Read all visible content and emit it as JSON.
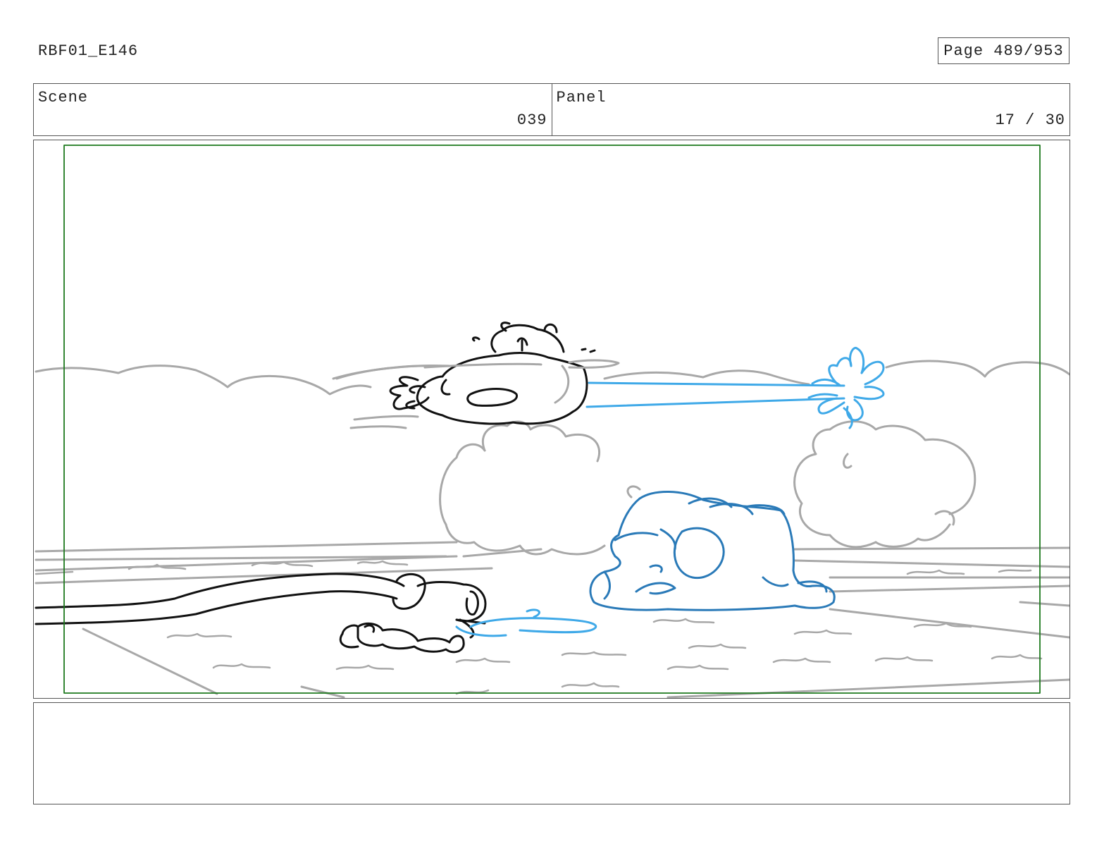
{
  "header": {
    "document_id": "RBF01_E146",
    "page_label": "Page 489/953"
  },
  "info": {
    "scene_label": "Scene",
    "scene_value": "039",
    "panel_label": "Panel",
    "panel_value": "17 / 30"
  },
  "drawing": {
    "safe_frame_color": "#1e7a1e",
    "background_line_color": "#a8a8a8",
    "character_line_color": "#111111",
    "water_color": "#3fa9e8",
    "blob_character_color": "#2a7ab8"
  },
  "notes": {
    "text": ""
  }
}
